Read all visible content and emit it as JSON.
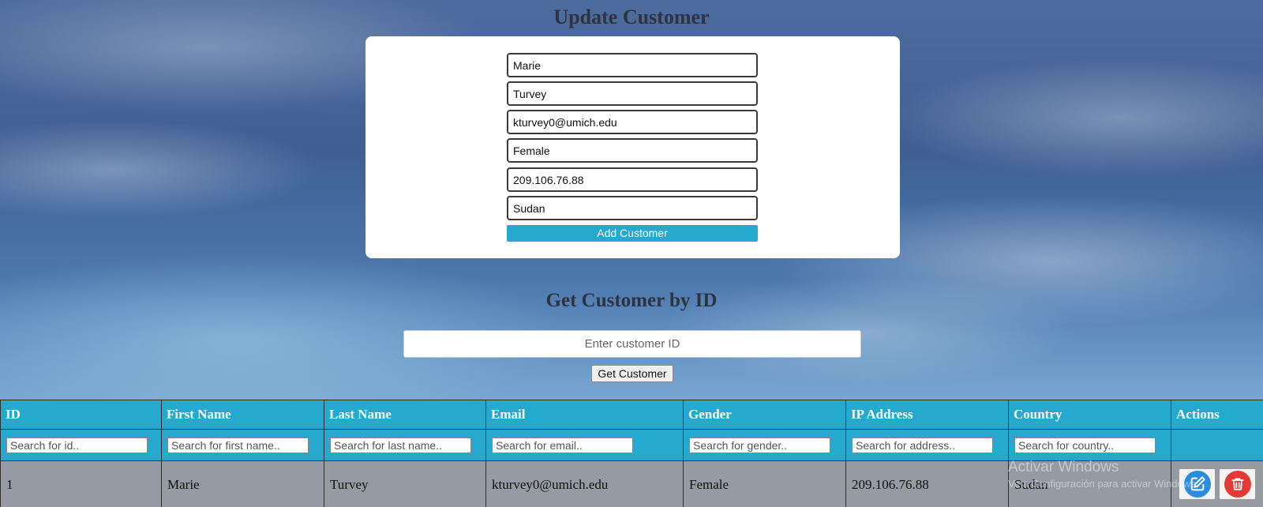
{
  "update_section": {
    "title": "Update Customer",
    "fields": {
      "first_name": "Marie",
      "last_name": "Turvey",
      "email": "kturvey0@umich.edu",
      "gender": "Female",
      "ip_address": "209.106.76.88",
      "country": "Sudan"
    },
    "submit_label": "Add Customer"
  },
  "get_section": {
    "title": "Get Customer by ID",
    "input_placeholder": "Enter customer ID",
    "button_label": "Get Customer"
  },
  "table": {
    "columns": [
      "ID",
      "First Name",
      "Last Name",
      "Email",
      "Gender",
      "IP Address",
      "Country",
      "Actions"
    ],
    "filters": [
      "Search for id..",
      "Search for first name..",
      "Search for last name..",
      "Search for email..",
      "Search for gender..",
      "Search for address..",
      "Search for country.."
    ],
    "rows": [
      {
        "id": "1",
        "first_name": "Marie",
        "last_name": "Turvey",
        "email": "kturvey0@umich.edu",
        "gender": "Female",
        "ip_address": "209.106.76.88",
        "country": "Sudan"
      }
    ],
    "actions": {
      "edit_icon": "edit-icon",
      "delete_icon": "trash-icon"
    }
  },
  "watermark": {
    "title": "Activar Windows",
    "subtitle": "Ve a Configuración para activar Windows."
  },
  "colors": {
    "accent": "#26a9cf",
    "row_background": "#969aa3",
    "edit_button": "#2b8be0",
    "delete_button": "#e53935"
  }
}
